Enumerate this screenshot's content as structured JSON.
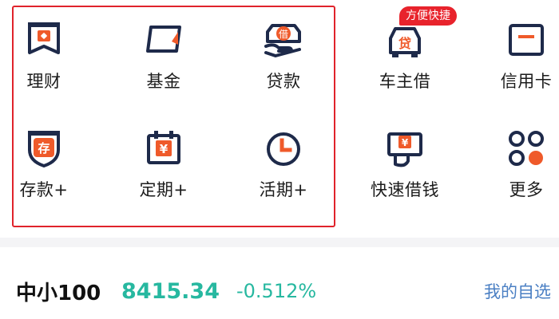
{
  "menu": {
    "items": [
      {
        "label": "理财",
        "icon": "wealth-icon"
      },
      {
        "label": "基金",
        "icon": "fund-icon"
      },
      {
        "label": "贷款",
        "icon": "loan-icon",
        "icon_text": "借"
      },
      {
        "label": "车主借",
        "icon": "car-loan-icon",
        "icon_text": "贷"
      },
      {
        "label": "信用卡",
        "icon": "credit-card-icon"
      },
      {
        "label": "存款+",
        "icon": "deposit-icon",
        "icon_text": "存"
      },
      {
        "label": "定期+",
        "icon": "fixed-term-icon",
        "icon_text": "¥"
      },
      {
        "label": "活期+",
        "icon": "demand-deposit-icon"
      },
      {
        "label": "快速借钱",
        "icon": "quick-cash-icon",
        "icon_text": "¥"
      },
      {
        "label": "更多",
        "icon": "more-icon"
      }
    ],
    "badge": "方便快捷"
  },
  "ticker": {
    "name": "中小100",
    "value": "8415.34",
    "change": "-0.512%",
    "watchlist_label": "我的自选"
  },
  "colors": {
    "accent_red": "#e8232c",
    "icon_navy": "#1e2a4a",
    "icon_orange": "#ef5a2a",
    "ticker_green": "#27b8a0",
    "link_blue": "#4a7fc3"
  }
}
